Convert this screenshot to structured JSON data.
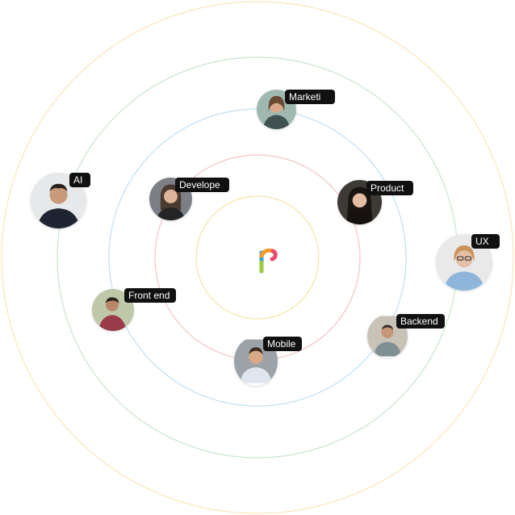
{
  "colors": {
    "ring_1": "#f6e4a6",
    "ring_2": "#f4c4c4",
    "ring_3": "#bfe0f5",
    "ring_4": "#c8e6cd",
    "ring_5": "#fbe6b8",
    "tag_background": "#111111",
    "tag_text": "#ffffff"
  },
  "logo": {
    "icon": "r-logo-icon"
  },
  "people": [
    {
      "id": "marketing",
      "label": "Marketi"
    },
    {
      "id": "ai",
      "label": "AI"
    },
    {
      "id": "developer",
      "label": "Develope"
    },
    {
      "id": "product",
      "label": "Product"
    },
    {
      "id": "ux",
      "label": "UX"
    },
    {
      "id": "frontend",
      "label": "Front end"
    },
    {
      "id": "backend",
      "label": "Backend"
    },
    {
      "id": "mobile",
      "label": "Mobile"
    }
  ]
}
